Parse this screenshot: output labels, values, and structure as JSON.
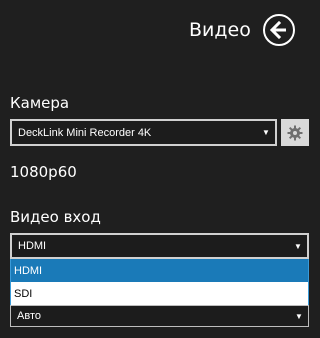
{
  "header": {
    "title": "Видео",
    "back_icon": "arrow-left-icon"
  },
  "camera": {
    "label": "Камера",
    "selected": "DeckLink Mini Recorder 4K",
    "settings_icon": "gear-icon"
  },
  "format": {
    "value": "1080p60"
  },
  "video_input": {
    "label": "Видео вход",
    "selected": "HDMI",
    "options": [
      "HDMI",
      "SDI"
    ]
  },
  "next_select": {
    "selected": "Авто"
  },
  "colors": {
    "background": "#1f1f1f",
    "accent_selected": "#1a7ab8",
    "dropdown_border": "#3a9bd9"
  }
}
